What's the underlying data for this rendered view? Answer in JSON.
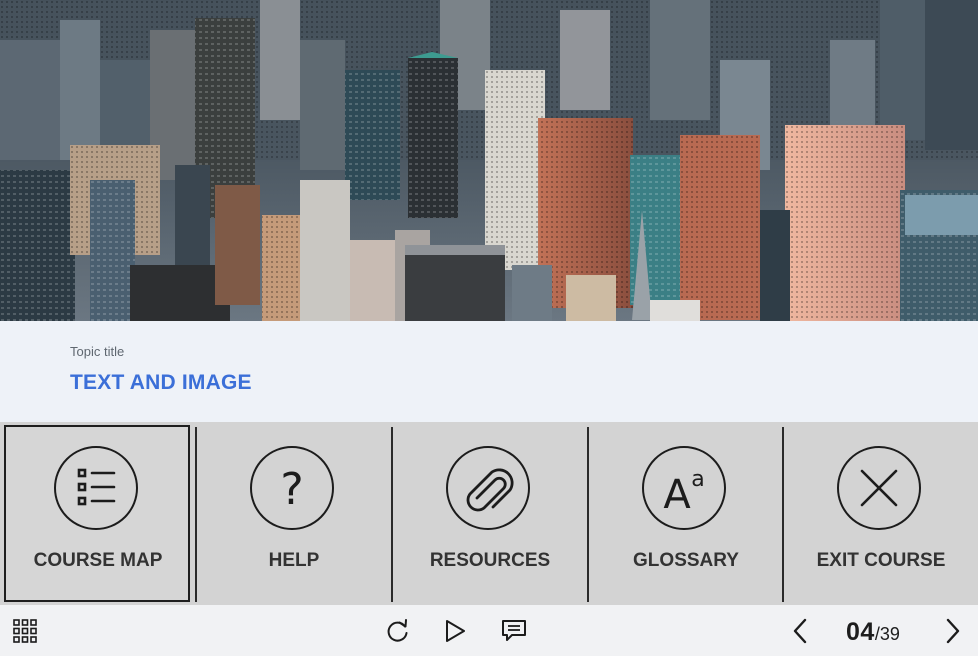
{
  "hero": {
    "image": "aerial city skyline with skyscrapers"
  },
  "topic": {
    "label": "Topic title",
    "title": "TEXT AND IMAGE"
  },
  "menu": {
    "items": [
      {
        "label": "COURSE MAP",
        "icon": "course-map-list-icon",
        "selected": true
      },
      {
        "label": "HELP",
        "icon": "question-mark-icon",
        "selected": false
      },
      {
        "label": "RESOURCES",
        "icon": "paperclip-icon",
        "selected": false
      },
      {
        "label": "GLOSSARY",
        "icon": "glossary-aa-icon",
        "selected": false
      },
      {
        "label": "EXIT COURSE",
        "icon": "close-x-icon",
        "selected": false
      }
    ]
  },
  "navbar": {
    "menu_icon": "grid-menu-icon",
    "replay_icon": "replay-icon",
    "play_icon": "play-icon",
    "transcript_icon": "transcript-icon",
    "prev_icon": "chevron-left-icon",
    "next_icon": "chevron-right-icon",
    "current_page": "04",
    "total_pages": "/39"
  },
  "colors": {
    "title_blue": "#3b6fd8",
    "menu_bg": "#d3d3d3",
    "title_band_bg": "#eef2f8",
    "navbar_bg": "#f1f2f4"
  }
}
